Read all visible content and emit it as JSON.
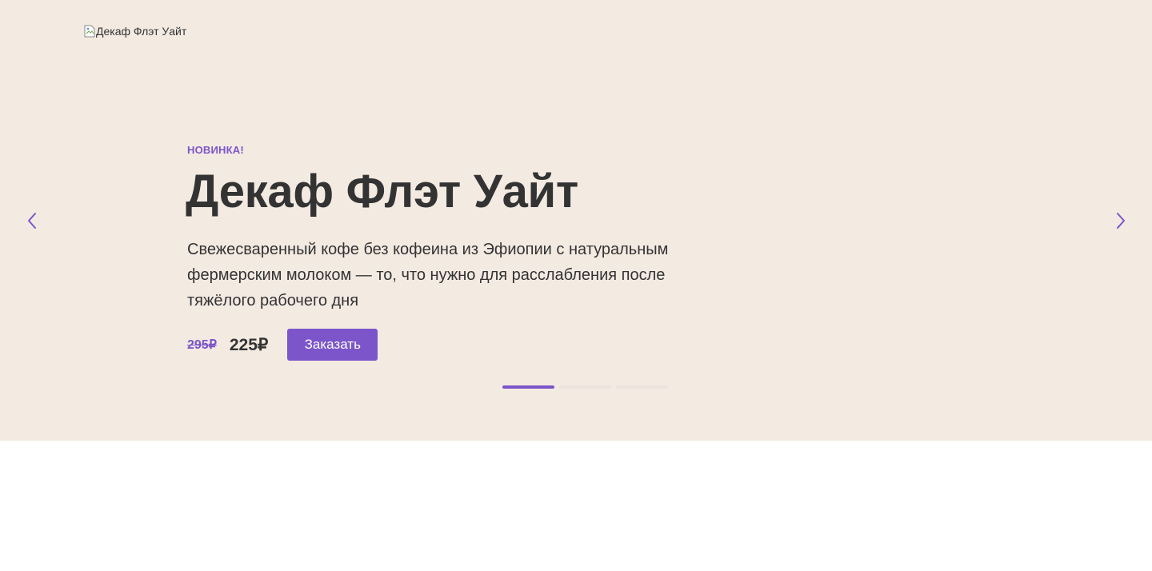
{
  "logo": {
    "alt_text": "Декаф Флэт Уайт"
  },
  "slide": {
    "badge": "НОВИНКА!",
    "title": "Декаф Флэт Уайт",
    "description": "Свежесваренный кофе без кофеина из Эфиопии с натуральным фермерским молоком — то, что нужно для расслабления после тяжёлого рабочего дня",
    "old_price": "295₽",
    "new_price": "225₽",
    "order_label": "Заказать"
  },
  "slider": {
    "dots": [
      "slide-1",
      "slide-2",
      "slide-3"
    ],
    "active_index": 0
  },
  "colors": {
    "accent": "#7b55c9",
    "hero_background": "#f3eae2",
    "text": "#333333"
  }
}
